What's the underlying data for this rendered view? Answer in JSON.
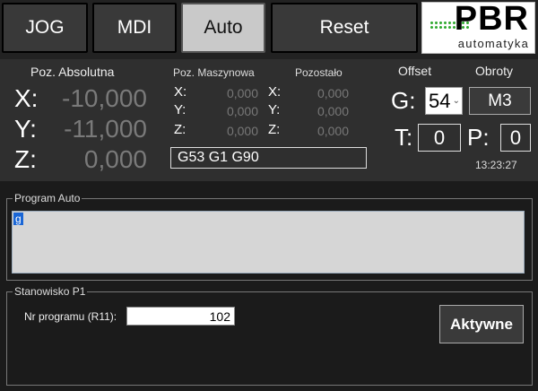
{
  "toolbar": {
    "jog": "JOG",
    "mdi": "MDI",
    "auto": "Auto",
    "reset": "Reset"
  },
  "logo": {
    "brand": "PBR",
    "sub": "automatyka"
  },
  "absolute": {
    "header": "Poz. Absolutna",
    "x_label": "X:",
    "x": "-10,000",
    "y_label": "Y:",
    "y": "-11,000",
    "z_label": "Z:",
    "z": "0,000"
  },
  "machine": {
    "header": "Poz. Maszynowa",
    "x_label": "X:",
    "x": "0,000",
    "y_label": "Y:",
    "y": "0,000",
    "z_label": "Z:",
    "z": "0,000"
  },
  "remaining": {
    "header": "Pozostało",
    "x_label": "X:",
    "x": "0,000",
    "y_label": "Y:",
    "y": "0,000",
    "z_label": "Z:",
    "z": "0,000"
  },
  "gcode_state": "G53 G1 G90",
  "offset": {
    "header": "Offset",
    "g_label": "G:",
    "g_value": "54"
  },
  "spindle": {
    "header": "Obroty",
    "m_value": "M3"
  },
  "tool": {
    "t_label": "T:",
    "t_value": "0"
  },
  "param": {
    "p_label": "P:",
    "p_value": "0"
  },
  "clock": "13:23:27",
  "program_auto": {
    "title": "Program Auto",
    "content": "g"
  },
  "station": {
    "title": "Stanowisko P1",
    "program_label": "Nr programu (R11):",
    "program_value": "102",
    "active_button": "Aktywne"
  }
}
